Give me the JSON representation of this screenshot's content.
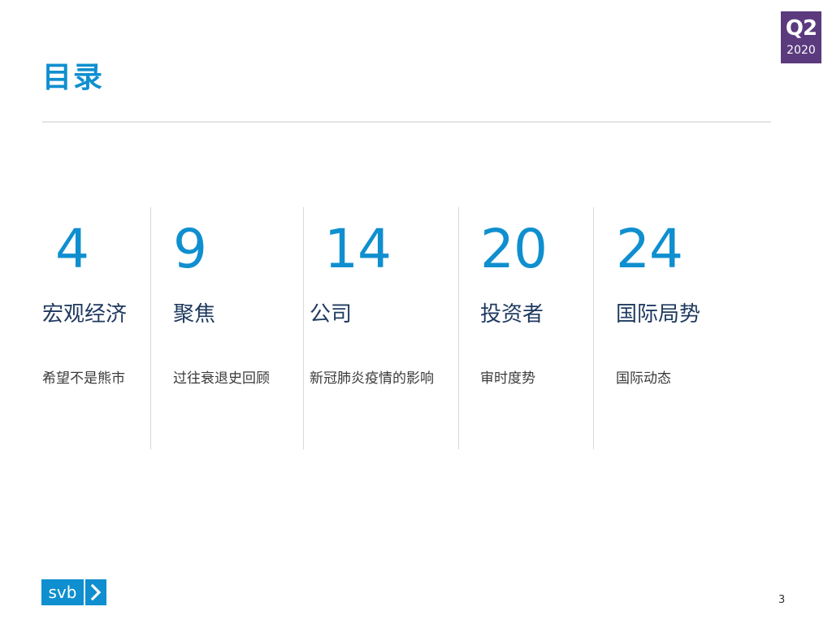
{
  "badge": {
    "quarter": "Q2",
    "year": "2020",
    "color": "#5b3a7e"
  },
  "title": "目录",
  "colors": {
    "accent": "#0f8fcf",
    "heading": "#1f3a5f",
    "divider": "#d9d9d9"
  },
  "sections": [
    {
      "page": "4",
      "heading": "宏观经济",
      "subtitle": "希望不是熊市"
    },
    {
      "page": "9",
      "heading": "聚焦",
      "subtitle": "过往衰退史回顾"
    },
    {
      "page": "14",
      "heading": "公司",
      "subtitle": "新冠肺炎疫情的影响"
    },
    {
      "page": "20",
      "heading": "投资者",
      "subtitle": "审时度势"
    },
    {
      "page": "24",
      "heading": "国际局势",
      "subtitle": "国际动态"
    }
  ],
  "footer": {
    "logo_text": "svb",
    "logo_icon": "chevron-right-icon",
    "page_number": "3"
  }
}
